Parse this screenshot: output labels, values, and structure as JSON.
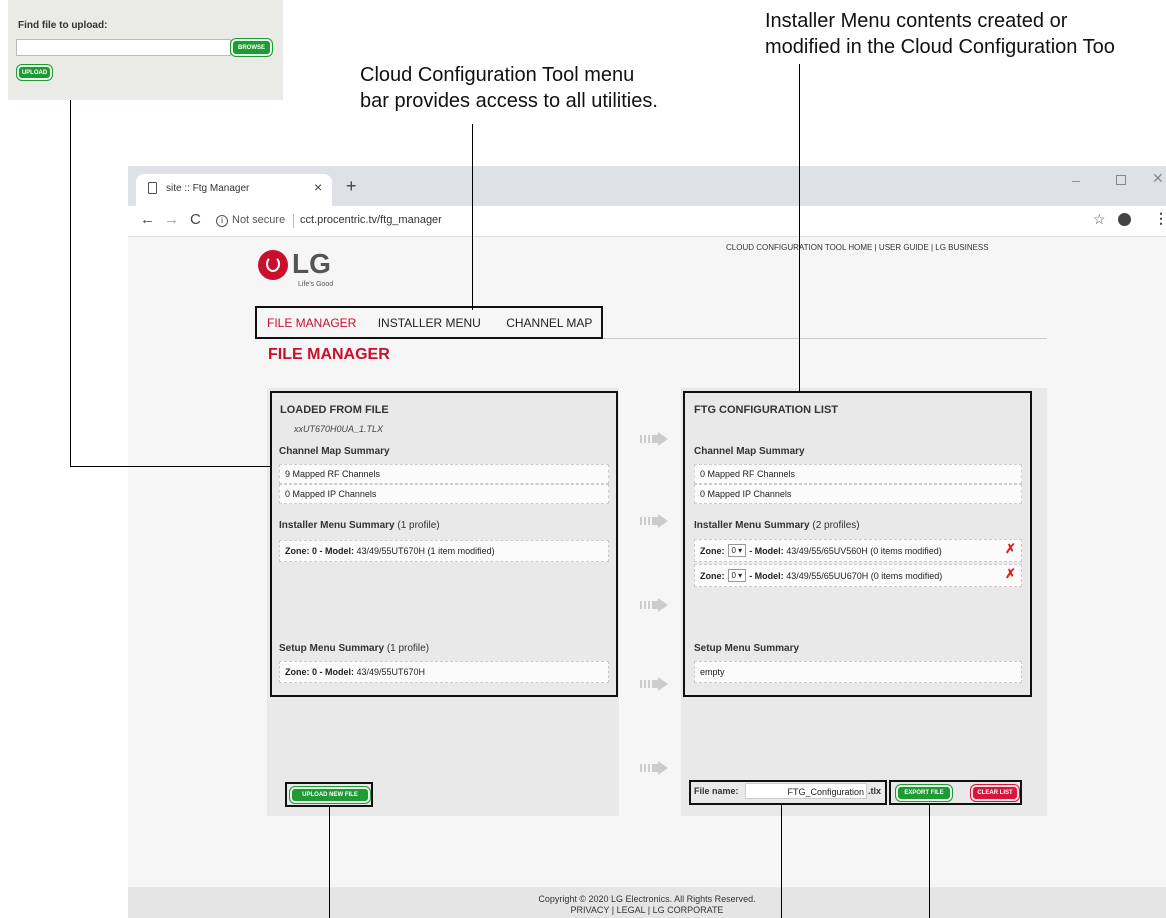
{
  "callouts": {
    "menu_bar": [
      "Cloud Configuration Tool menu",
      "bar provides access to all utilities."
    ],
    "ftg_list": [
      "Installer Menu contents created or",
      "modified in the Cloud Configuration Too"
    ]
  },
  "inset": {
    "label": "Find file to upload:",
    "browse_label": "BROWSE",
    "upload_label": "UPLOAD"
  },
  "browser": {
    "tab_title": "site :: Ftg Manager",
    "not_secure": "Not secure",
    "url": "cct.procentric.tv/ftg_manager"
  },
  "site": {
    "top_links": [
      "CLOUD CONFIGURATION TOOL HOME",
      "USER GUIDE",
      "LG BUSINESS"
    ],
    "logo_text": "LG",
    "tagline": "Life's Good",
    "nav": [
      "FILE MANAGER",
      "INSTALLER MENU",
      "CHANNEL MAP"
    ],
    "page_title": "FILE MANAGER"
  },
  "loaded": {
    "title": "LOADED FROM FILE",
    "filename": "xxUT670H0UA_1.TLX",
    "channel_summary_title": "Channel Map Summary",
    "channel_rows": [
      "9 Mapped RF Channels",
      "0 Mapped IP Channels"
    ],
    "installer_title": "Installer Menu Summary",
    "installer_count": "(1 profile)",
    "installer_zone": "Zone: 0 - Model:",
    "installer_model": "43/49/55UT670H (1 item modified)",
    "setup_title": "Setup Menu Summary",
    "setup_count": "(1 profile)",
    "setup_zone": "Zone: 0 - Model:",
    "setup_model": "43/49/55UT670H",
    "upload_new_label": "UPLOAD NEW FILE"
  },
  "ftg": {
    "title": "FTG CONFIGURATION LIST",
    "channel_summary_title": "Channel Map Summary",
    "channel_rows": [
      "0 Mapped RF Channels",
      "0 Mapped IP Channels"
    ],
    "installer_title": "Installer Menu Summary",
    "installer_count": "(2 profiles)",
    "zone_label": "Zone:",
    "zone_value": "0 ▾",
    "model_label": "- Model:",
    "profiles": [
      "43/49/55/65UV560H (0 items modified)",
      "43/49/55/65UU670H (0 items modified)"
    ],
    "setup_title": "Setup Menu Summary",
    "setup_row": "empty",
    "file_name_label": "File name:",
    "file_name_value": "FTG_Configuration",
    "file_ext": ".tlx",
    "export_label": "EXPORT FILE",
    "clear_label": "CLEAR LIST"
  },
  "footer": {
    "copyright": "Copyright © 2020 LG Electronics. All Rights Reserved.",
    "links": [
      "PRIVACY",
      "LEGAL",
      "LG CORPORATE"
    ]
  },
  "colors": {
    "accent_red": "#c8102e",
    "green_button": "#1f9a34",
    "red_button": "#d9153c"
  }
}
